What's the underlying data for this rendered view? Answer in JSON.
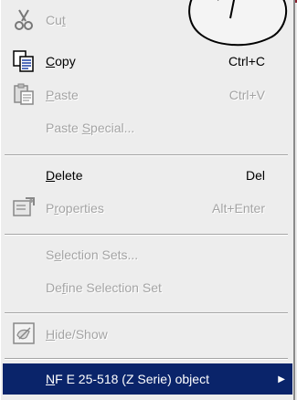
{
  "menu": {
    "items": [
      {
        "id": "cut",
        "prefix": "Cu",
        "u": "t",
        "suffix": "",
        "shortcut": "",
        "disabled": true,
        "icon": "scissors-icon"
      },
      {
        "id": "copy",
        "prefix": "",
        "u": "C",
        "suffix": "opy",
        "shortcut": "Ctrl+C",
        "disabled": false,
        "icon": "copy-icon"
      },
      {
        "id": "paste",
        "prefix": "",
        "u": "P",
        "suffix": "aste",
        "shortcut": "Ctrl+V",
        "disabled": true,
        "icon": "paste-icon"
      },
      {
        "id": "paste-special",
        "prefix": "Paste ",
        "u": "S",
        "suffix": "pecial...",
        "shortcut": "",
        "disabled": true,
        "icon": ""
      },
      {
        "id": "delete",
        "prefix": "",
        "u": "D",
        "suffix": "elete",
        "shortcut": "Del",
        "disabled": false,
        "icon": ""
      },
      {
        "id": "properties",
        "prefix": "P",
        "u": "r",
        "suffix": "operties",
        "shortcut": "Alt+Enter",
        "disabled": true,
        "icon": "properties-icon"
      },
      {
        "id": "selection-sets",
        "prefix": "S",
        "u": "e",
        "suffix": "lection Sets...",
        "shortcut": "",
        "disabled": true,
        "icon": ""
      },
      {
        "id": "define-selection-set",
        "prefix": "De",
        "u": "f",
        "suffix": "ine Selection Set",
        "shortcut": "",
        "disabled": true,
        "icon": ""
      },
      {
        "id": "hide-show",
        "prefix": "",
        "u": "H",
        "suffix": "ide/Show",
        "shortcut": "",
        "disabled": true,
        "icon": "hide-show-icon"
      },
      {
        "id": "nf-object",
        "prefix": "",
        "u": "N",
        "suffix": "F E 25-518 (Z Serie) object",
        "shortcut": "",
        "disabled": false,
        "icon": "",
        "submenu_arrow": "▶"
      }
    ]
  },
  "colors": {
    "menu_bg": "#ededed",
    "selection_bg": "#0a246a",
    "disabled_text": "#a4a4a4"
  }
}
